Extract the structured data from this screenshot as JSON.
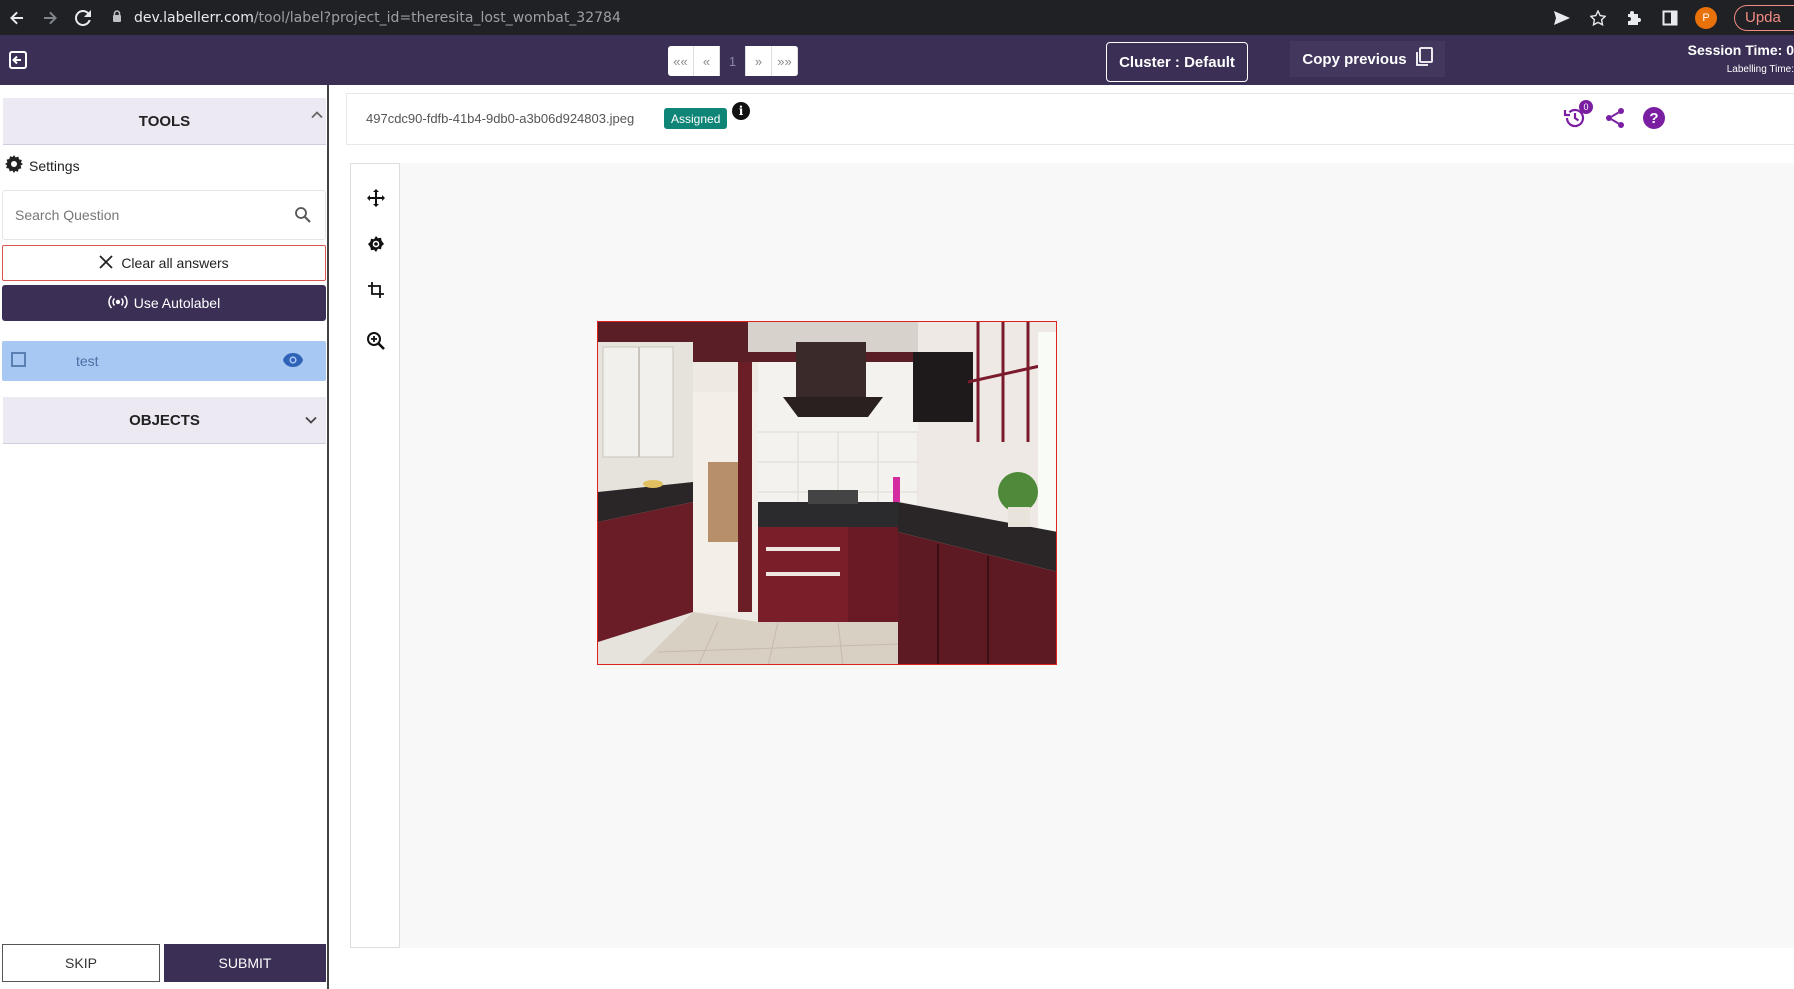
{
  "browser": {
    "url_host": "dev.labellerr.com",
    "url_path": "/tool/label?project_id=theresita_lost_wombat_32784",
    "profile_initial": "P",
    "update_label": "Upda"
  },
  "header": {
    "pager": [
      "««",
      "«",
      "1",
      "»",
      "»»"
    ],
    "cluster_label": "Cluster : Default",
    "copy_previous_label": "Copy previous",
    "session_time_label": "Session Time: 0",
    "labelling_time_label": "Labelling Time:"
  },
  "sidebar": {
    "tools_title": "TOOLS",
    "settings_label": "Settings",
    "search_placeholder": "Search Question",
    "clear_label": "Clear all answers",
    "autolabel_label": "Use Autolabel",
    "question_label": "test",
    "objects_title": "OBJECTS",
    "skip_label": "SKIP",
    "submit_label": "SUBMIT"
  },
  "file": {
    "name": "497cdc90-fdfb-41b4-9db0-a3b06d924803.jpeg",
    "status": "Assigned",
    "info_glyph": "i",
    "history_count": "0",
    "help_glyph": "?"
  },
  "colors": {
    "appbar": "#3b2f55",
    "accent_purple": "#7a1fa2",
    "status_badge": "#0f8577",
    "question_row": "#a7c8f2"
  }
}
